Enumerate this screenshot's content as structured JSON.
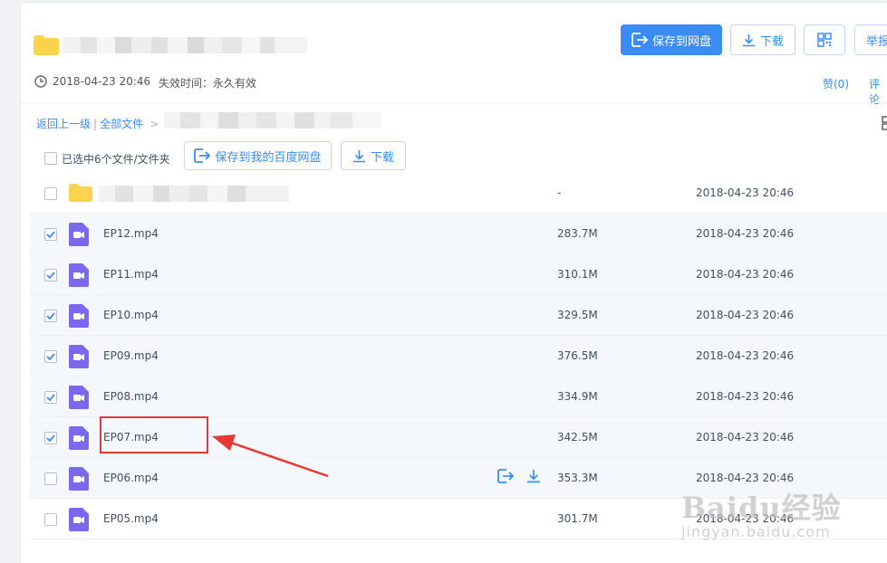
{
  "header": {
    "created": "2018-04-23 20:46",
    "expire_label": "失效时间：永久有效",
    "buttons": {
      "save": "保存到网盘",
      "download": "下载",
      "report": "举报"
    },
    "like": "赞(0)",
    "comment": "评论"
  },
  "breadcrumb": {
    "back": "返回上一级",
    "separator": "|",
    "all_files": "全部文件",
    "arrow": ">"
  },
  "toolbar": {
    "selected": "已选中6个文件/文件夹",
    "save_to_baidu": "保存到我的百度网盘",
    "download": "下载"
  },
  "files": [
    {
      "name": "",
      "type": "folder",
      "size": "-",
      "date": "2018-04-23 20:46",
      "checked": false
    },
    {
      "name": "EP12.mp4",
      "type": "video",
      "size": "283.7M",
      "date": "2018-04-23 20:46",
      "checked": true
    },
    {
      "name": "EP11.mp4",
      "type": "video",
      "size": "310.1M",
      "date": "2018-04-23 20:46",
      "checked": true
    },
    {
      "name": "EP10.mp4",
      "type": "video",
      "size": "329.5M",
      "date": "2018-04-23 20:46",
      "checked": true
    },
    {
      "name": "EP09.mp4",
      "type": "video",
      "size": "376.5M",
      "date": "2018-04-23 20:46",
      "checked": true
    },
    {
      "name": "EP08.mp4",
      "type": "video",
      "size": "334.9M",
      "date": "2018-04-23 20:46",
      "checked": true
    },
    {
      "name": "EP07.mp4",
      "type": "video",
      "size": "342.5M",
      "date": "2018-04-23 20:46",
      "checked": true
    },
    {
      "name": "EP06.mp4",
      "type": "video",
      "size": "353.3M",
      "date": "2018-04-23 20:46",
      "checked": false,
      "hover": true
    },
    {
      "name": "EP05.mp4",
      "type": "video",
      "size": "301.7M",
      "date": "2018-04-23 20:46",
      "checked": false
    }
  ],
  "watermark": {
    "brand": "Baidu经验",
    "url": "jingyan.baidu.com"
  },
  "colors": {
    "accent": "#3b8cf7",
    "video_icon": "#7b68ee",
    "folder": "#fcd34d",
    "annotation": "#e53935"
  }
}
